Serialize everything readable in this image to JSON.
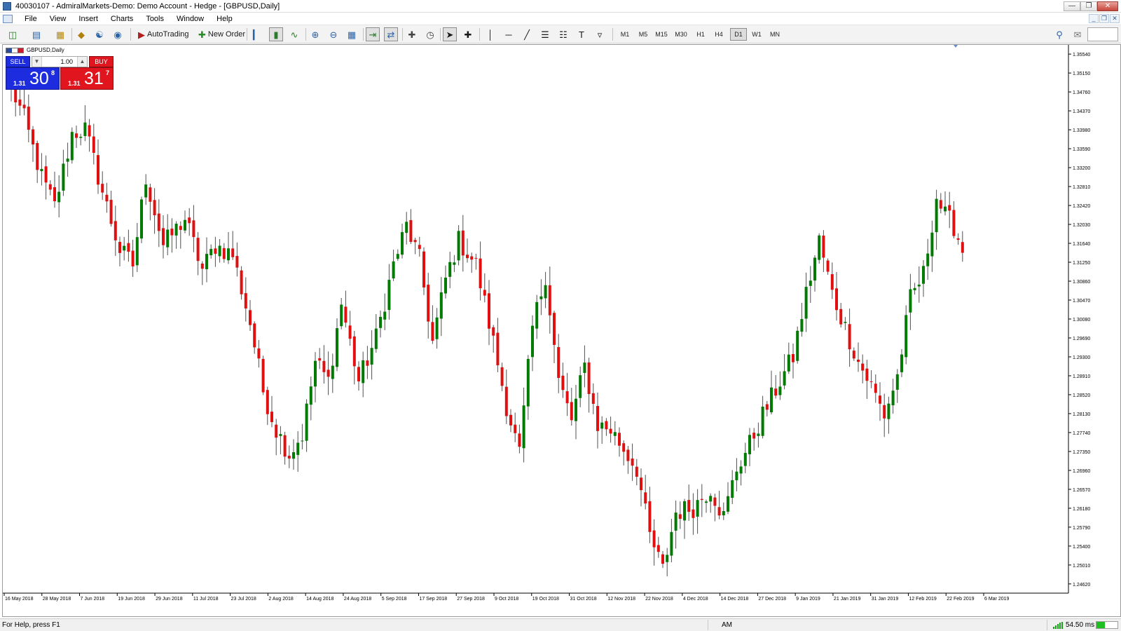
{
  "window": {
    "title": "40030107 - AdmiralMarkets-Demo: Demo Account - Hedge - [GBPUSD,Daily]",
    "controls": [
      "minimize",
      "restore",
      "close"
    ]
  },
  "menu": {
    "items": [
      "File",
      "View",
      "Insert",
      "Charts",
      "Tools",
      "Window",
      "Help"
    ]
  },
  "toolbar": {
    "autotrading_label": "AutoTrading",
    "new_order_label": "New Order",
    "timeframes": [
      "M1",
      "M5",
      "M15",
      "M30",
      "H1",
      "H4",
      "D1",
      "W1",
      "MN"
    ],
    "active_timeframe": "D1"
  },
  "chart": {
    "label": "GBPUSD,Daily",
    "symbol": "GBPUSD",
    "period": "Daily"
  },
  "trade_panel": {
    "sell_label": "SELL",
    "buy_label": "BUY",
    "lot": "1.00",
    "sell_prefix": "1.31",
    "sell_big": "30",
    "sell_sup": "8",
    "buy_prefix": "1.31",
    "buy_big": "31",
    "buy_sup": "7",
    "sell_color": "#1e2ce0",
    "buy_color": "#e0151e"
  },
  "chart_data": {
    "type": "candlestick",
    "series_colors": {
      "bull": "#007a00",
      "bear": "#e01010",
      "wick": "#505050"
    },
    "y_ticks": [
      "1.35540",
      "1.35150",
      "1.34760",
      "1.34370",
      "1.33980",
      "1.33590",
      "1.33200",
      "1.32810",
      "1.32420",
      "1.32030",
      "1.31640",
      "1.31250",
      "1.30860",
      "1.30470",
      "1.30080",
      "1.29690",
      "1.29300",
      "1.28910",
      "1.28520",
      "1.28130",
      "1.27740",
      "1.27350",
      "1.26960",
      "1.26570",
      "1.26180",
      "1.25790",
      "1.25400",
      "1.25010",
      "1.24620"
    ],
    "ylim": [
      1.2443,
      1.3573
    ],
    "x_ticks": [
      "16 May 2018",
      "28 May 2018",
      "7 Jun 2018",
      "19 Jun 2018",
      "29 Jun 2018",
      "11 Jul 2018",
      "23 Jul 2018",
      "2 Aug 2018",
      "14 Aug 2018",
      "24 Aug 2018",
      "5 Sep 2018",
      "17 Sep 2018",
      "27 Sep 2018",
      "9 Oct 2018",
      "19 Oct 2018",
      "31 Oct 2018",
      "12 Nov 2018",
      "22 Nov 2018",
      "4 Dec 2018",
      "14 Dec 2018",
      "27 Dec 2018",
      "9 Jan 2019",
      "21 Jan 2019",
      "31 Jan 2019",
      "12 Feb 2019",
      "22 Feb 2019",
      "6 Mar 2019"
    ],
    "anchors": [
      [
        0,
        1.3485
      ],
      [
        3,
        1.342
      ],
      [
        7,
        1.33
      ],
      [
        10,
        1.324
      ],
      [
        14,
        1.339
      ],
      [
        17,
        1.34
      ],
      [
        21,
        1.327
      ],
      [
        25,
        1.315
      ],
      [
        28,
        1.312
      ],
      [
        31,
        1.33
      ],
      [
        35,
        1.316
      ],
      [
        40,
        1.3215
      ],
      [
        44,
        1.311
      ],
      [
        47,
        1.316
      ],
      [
        51,
        1.314
      ],
      [
        55,
        1.3
      ],
      [
        58,
        1.286
      ],
      [
        61,
        1.278
      ],
      [
        64,
        1.273
      ],
      [
        67,
        1.277
      ],
      [
        70,
        1.292
      ],
      [
        73,
        1.288
      ],
      [
        76,
        1.304
      ],
      [
        80,
        1.288
      ],
      [
        84,
        1.297
      ],
      [
        88,
        1.312
      ],
      [
        91,
        1.32
      ],
      [
        94,
        1.313
      ],
      [
        97,
        1.296
      ],
      [
        100,
        1.309
      ],
      [
        103,
        1.317
      ],
      [
        107,
        1.312
      ],
      [
        111,
        1.296
      ],
      [
        114,
        1.283
      ],
      [
        117,
        1.273
      ],
      [
        120,
        1.299
      ],
      [
        123,
        1.31
      ],
      [
        126,
        1.288
      ],
      [
        129,
        1.28
      ],
      [
        132,
        1.291
      ],
      [
        135,
        1.279
      ],
      [
        138,
        1.278
      ],
      [
        141,
        1.274
      ],
      [
        144,
        1.27
      ],
      [
        147,
        1.256
      ],
      [
        150,
        1.249
      ],
      [
        153,
        1.261
      ],
      [
        157,
        1.262
      ],
      [
        161,
        1.266
      ],
      [
        164,
        1.26
      ],
      [
        167,
        1.27
      ],
      [
        170,
        1.275
      ],
      [
        173,
        1.281
      ],
      [
        177,
        1.288
      ],
      [
        180,
        1.293
      ],
      [
        183,
        1.306
      ],
      [
        186,
        1.317
      ],
      [
        189,
        1.306
      ],
      [
        192,
        1.299
      ],
      [
        195,
        1.292
      ],
      [
        198,
        1.287
      ],
      [
        201,
        1.281
      ],
      [
        204,
        1.289
      ],
      [
        207,
        1.305
      ],
      [
        210,
        1.31
      ],
      [
        213,
        1.326
      ],
      [
        215,
        1.322
      ],
      [
        217,
        1.32
      ],
      [
        219,
        1.315
      ]
    ],
    "note": "Daily GBPUSD candlesticks ~220 bars from 16 May 2018 to 6 Mar 2019; close path anchored to visible chart"
  },
  "status": {
    "help_text": "For Help, press F1",
    "profile": "AM",
    "ping": "54.50 ms",
    "progress": 0.4
  }
}
